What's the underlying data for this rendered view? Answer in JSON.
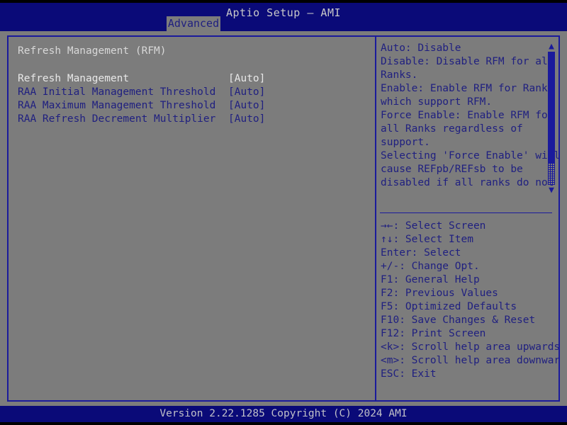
{
  "window": {
    "title": "Aptio Setup – AMI"
  },
  "tabs": [
    {
      "label": "Advanced",
      "active": true
    }
  ],
  "main": {
    "section_title": "Refresh Management (RFM)",
    "options": [
      {
        "label": "Refresh Management",
        "value": "[Auto]",
        "selected": true
      },
      {
        "label": "RAA Initial Management Threshold",
        "value": "[Auto]",
        "selected": false
      },
      {
        "label": "RAA Maximum Management Threshold",
        "value": "[Auto]",
        "selected": false
      },
      {
        "label": "RAA Refresh Decrement Multiplier",
        "value": "[Auto]",
        "selected": false
      }
    ]
  },
  "help": {
    "lines": [
      "Auto: Disable",
      "Disable: Disable RFM for all",
      "Ranks.",
      "Enable: Enable RFM for Ranks",
      "which support RFM.",
      "Force Enable: Enable RFM for",
      "all Ranks regardless of",
      "support.",
      "Selecting 'Force Enable' will",
      "cause REFpb/REFsb to be",
      "disabled if all ranks do not"
    ],
    "scroll_up_glyph": "▲",
    "scroll_down_glyph": "▼"
  },
  "keys": [
    "→←: Select Screen",
    "↑↓: Select Item",
    "Enter: Select",
    "+/-: Change Opt.",
    "F1: General Help",
    "F2: Previous Values",
    "F5: Optimized Defaults",
    "F10: Save Changes & Reset",
    "F12: Print Screen",
    "<k>: Scroll help area upwards",
    "<m>: Scroll help area downwards",
    "ESC: Exit"
  ],
  "footer": {
    "version": "Version 2.22.1285 Copyright (C) 2024 AMI"
  },
  "colors": {
    "header_blue": "#0a0a78",
    "frame_blue": "#1a1a9c",
    "text_blue": "#202080",
    "background_gray": "#7c7c7c",
    "selected_text": "#e8e8e8"
  }
}
